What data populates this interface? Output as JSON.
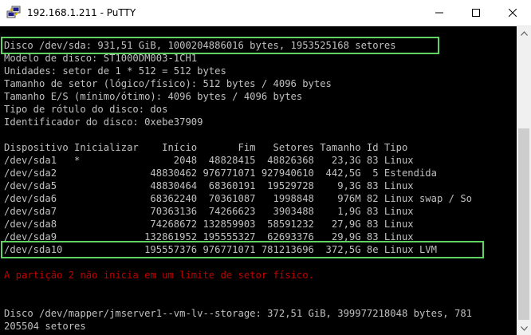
{
  "window": {
    "title": "192.168.1.211 - PuTTY",
    "icons": {
      "app": "putty-icon",
      "minimize": "minimize-icon",
      "maximize": "maximize-icon",
      "close": "close-icon"
    }
  },
  "terminal": {
    "lines": [
      "Disco /dev/sda: 931,51 GiB, 1000204886016 bytes, 1953525168 setores",
      "Modelo de disco: ST1000DM003-1CH1",
      "Unidades: setor de 1 * 512 = 512 bytes",
      "Tamanho de setor (lógico/físico): 512 bytes / 4096 bytes",
      "Tamanho E/S (mínimo/ótimo): 4096 bytes / 4096 bytes",
      "Tipo de rótulo do disco: dos",
      "Identificador do disco: 0xebe37909",
      "",
      "Dispositivo Inicializar    Início       Fim   Setores Tamanho Id Tipo",
      "/dev/sda1   *                2048  48828415  48826368   23,3G 83 Linux",
      "/dev/sda2                48830462 976771071 927940610  442,5G  5 Estendida",
      "/dev/sda5                48830464  68360191  19529728    9,3G 83 Linux",
      "/dev/sda6                68362240  70361087   1998848    976M 82 Linux swap / So",
      "/dev/sda7                70363136  74266623   3903488    1,9G 83 Linux",
      "/dev/sda8                74268672 132859903  58591232   27,9G 83 Linux",
      "/dev/sda9               132861952 195555327  62693376   29,9G 83 Linux",
      "/dev/sda10              195557376 976771071 781213696  372,5G 8e Linux LVM",
      "",
      "A partição 2 não inicia em um limite de setor físico.",
      "",
      "",
      "Disco /dev/mapper/jmserver1--vm-lv--storage: 372,51 GiB, 399977218048 bytes, 781",
      "205504 setores"
    ],
    "colors": {
      "background": "#000000",
      "text": "#c0c0c0",
      "warning": "#c00000",
      "highlight": "#62d262"
    }
  }
}
